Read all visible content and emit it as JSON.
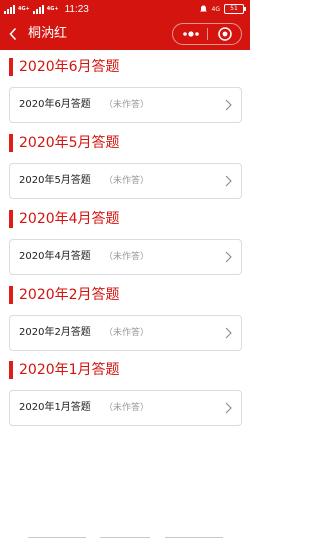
{
  "status_bar": {
    "network_label": "4G+",
    "network_label_2": "4G+",
    "time": "11:23",
    "right_label": "4G",
    "battery": "51"
  },
  "header": {
    "title": "桐汭红"
  },
  "sections": [
    {
      "title": "2020年6月答题",
      "item_title": "2020年6月答题",
      "item_status": "（未作答）"
    },
    {
      "title": "2020年5月答题",
      "item_title": "2020年5月答题",
      "item_status": "（未作答）"
    },
    {
      "title": "2020年4月答题",
      "item_title": "2020年4月答题",
      "item_status": "（未作答）"
    },
    {
      "title": "2020年2月答题",
      "item_title": "2020年2月答题",
      "item_status": "（未作答）"
    },
    {
      "title": "2020年1月答题",
      "item_title": "2020年1月答题",
      "item_status": "（未作答）"
    }
  ],
  "colors": {
    "accent": "#d3140f",
    "section_bar": "#e01c19",
    "status_text": "#9a9a9a"
  }
}
